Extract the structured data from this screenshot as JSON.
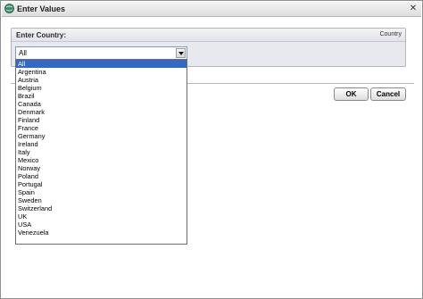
{
  "window": {
    "title": "Enter Values",
    "close_symbol": "✕"
  },
  "group": {
    "label": "Enter Country:",
    "right_label": "Country"
  },
  "select": {
    "value": "All"
  },
  "buttons": {
    "ok": "OK",
    "cancel": "Cancel"
  },
  "dropdown": {
    "selected_index": 0,
    "options": [
      "All",
      "Argentina",
      "Austria",
      "Belgium",
      "Brazil",
      "Canada",
      "Denmark",
      "Finland",
      "France",
      "Germany",
      "Ireland",
      "Italy",
      "Mexico",
      "Norway",
      "Poland",
      "Portugal",
      "Spain",
      "Sweden",
      "Switzerland",
      "UK",
      "USA",
      "Venezuela"
    ]
  },
  "colors": {
    "selection": "#316ac5",
    "group_bg": "#e8e9ef"
  },
  "icons": {
    "title": "app-globe-icon",
    "select_arrow": "chevron-down-icon",
    "close": "close-icon"
  }
}
